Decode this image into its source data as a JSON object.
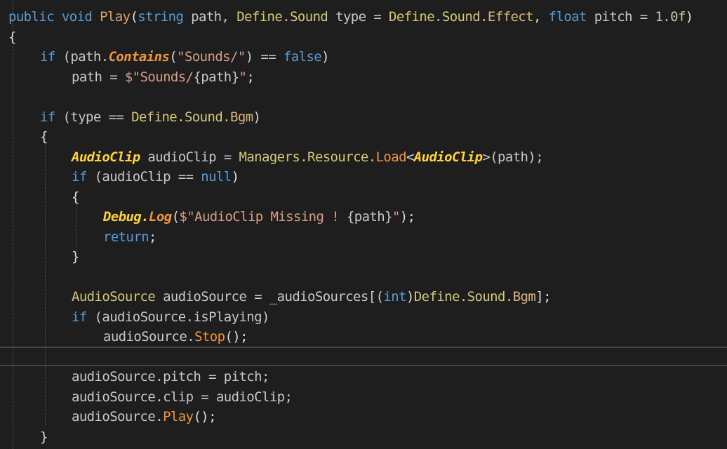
{
  "palette": {
    "background": "#1e1e1e",
    "keyword": "#569cd6",
    "method": "#dcdcaa",
    "method_orange": "#d8a36a",
    "enum_member": "#d8b47c",
    "class_type": "#d4c878",
    "class_italic": "#ffd23c",
    "ext_method": "#f09440",
    "string": "#d69d85",
    "identifier": "#c8c8c8",
    "number": "#b5cea8",
    "punctuation": "#dcdcdc",
    "indent_guide": "#4a4a4a",
    "current_line_border": "#464646"
  },
  "code_lines": [
    {
      "indent": 0,
      "tokens": [
        {
          "t": "public ",
          "k": "keyword"
        },
        {
          "t": "void ",
          "k": "keyword"
        },
        {
          "t": "Play",
          "k": "method_orange"
        },
        {
          "t": "(",
          "k": "punctuation"
        },
        {
          "t": "string ",
          "k": "keyword"
        },
        {
          "t": "path, ",
          "k": "identifier"
        },
        {
          "t": "Define.Sound ",
          "k": "class_type"
        },
        {
          "t": "type = ",
          "k": "identifier"
        },
        {
          "t": "Define.Sound.",
          "k": "class_type"
        },
        {
          "t": "Effect",
          "k": "enum_member"
        },
        {
          "t": ", ",
          "k": "punctuation"
        },
        {
          "t": "float ",
          "k": "keyword"
        },
        {
          "t": "pitch = ",
          "k": "identifier"
        },
        {
          "t": "1.0f",
          "k": "number"
        },
        {
          "t": ")",
          "k": "punctuation"
        }
      ]
    },
    {
      "indent": 0,
      "tokens": [
        {
          "t": "{",
          "k": "punctuation"
        }
      ]
    },
    {
      "indent": 1,
      "tokens": [
        {
          "t": "if ",
          "k": "keyword"
        },
        {
          "t": "(path.",
          "k": "identifier"
        },
        {
          "t": "Contains",
          "k": "ext_method",
          "i": true
        },
        {
          "t": "(",
          "k": "punctuation"
        },
        {
          "t": "\"Sounds/\"",
          "k": "string"
        },
        {
          "t": ") == ",
          "k": "identifier"
        },
        {
          "t": "false",
          "k": "keyword"
        },
        {
          "t": ")",
          "k": "punctuation"
        }
      ]
    },
    {
      "indent": 2,
      "tokens": [
        {
          "t": "path = ",
          "k": "identifier"
        },
        {
          "t": "$\"Sounds/",
          "k": "string"
        },
        {
          "t": "{path}",
          "k": "identifier"
        },
        {
          "t": "\"",
          "k": "string"
        },
        {
          "t": ";",
          "k": "punctuation"
        }
      ]
    },
    {
      "indent": 0,
      "tokens": []
    },
    {
      "indent": 1,
      "tokens": [
        {
          "t": "if ",
          "k": "keyword"
        },
        {
          "t": "(type == ",
          "k": "identifier"
        },
        {
          "t": "Define.Sound.",
          "k": "class_type"
        },
        {
          "t": "Bgm",
          "k": "enum_member"
        },
        {
          "t": ")",
          "k": "punctuation"
        }
      ]
    },
    {
      "indent": 1,
      "tokens": [
        {
          "t": "{",
          "k": "punctuation"
        }
      ]
    },
    {
      "indent": 2,
      "tokens": [
        {
          "t": "AudioClip",
          "k": "class_italic",
          "i": true
        },
        {
          "t": " audioClip = ",
          "k": "identifier"
        },
        {
          "t": "Managers.Resource.",
          "k": "class_type"
        },
        {
          "t": "Load",
          "k": "ext_method"
        },
        {
          "t": "<",
          "k": "punctuation"
        },
        {
          "t": "AudioClip",
          "k": "class_italic",
          "i": true
        },
        {
          "t": ">(path);",
          "k": "identifier"
        }
      ]
    },
    {
      "indent": 2,
      "tokens": [
        {
          "t": "if ",
          "k": "keyword"
        },
        {
          "t": "(audioClip == ",
          "k": "identifier"
        },
        {
          "t": "null",
          "k": "keyword"
        },
        {
          "t": ")",
          "k": "punctuation"
        }
      ]
    },
    {
      "indent": 2,
      "tokens": [
        {
          "t": "{",
          "k": "punctuation"
        }
      ]
    },
    {
      "indent": 3,
      "tokens": [
        {
          "t": "Debug.",
          "k": "class_italic",
          "i": true
        },
        {
          "t": "Log",
          "k": "ext_method",
          "i": true
        },
        {
          "t": "(",
          "k": "punctuation"
        },
        {
          "t": "$\"AudioClip Missing ! ",
          "k": "string"
        },
        {
          "t": "{path}",
          "k": "identifier"
        },
        {
          "t": "\"",
          "k": "string"
        },
        {
          "t": ");",
          "k": "punctuation"
        }
      ]
    },
    {
      "indent": 3,
      "tokens": [
        {
          "t": "return",
          "k": "keyword"
        },
        {
          "t": ";",
          "k": "punctuation"
        }
      ]
    },
    {
      "indent": 2,
      "tokens": [
        {
          "t": "}",
          "k": "punctuation"
        }
      ]
    },
    {
      "indent": 0,
      "tokens": []
    },
    {
      "indent": 2,
      "tokens": [
        {
          "t": "AudioSource",
          "k": "class_type"
        },
        {
          "t": " audioSource = _audioSources[(",
          "k": "identifier"
        },
        {
          "t": "int",
          "k": "keyword"
        },
        {
          "t": ")",
          "k": "punctuation"
        },
        {
          "t": "Define.Sound.",
          "k": "class_type"
        },
        {
          "t": "Bgm",
          "k": "enum_member"
        },
        {
          "t": "];",
          "k": "punctuation"
        }
      ]
    },
    {
      "indent": 2,
      "tokens": [
        {
          "t": "if ",
          "k": "keyword"
        },
        {
          "t": "(audioSource.isPlaying)",
          "k": "identifier"
        }
      ]
    },
    {
      "indent": 3,
      "tokens": [
        {
          "t": "audioSource.",
          "k": "identifier"
        },
        {
          "t": "Stop",
          "k": "ext_method"
        },
        {
          "t": "();",
          "k": "punctuation"
        }
      ]
    },
    {
      "indent": 0,
      "tokens": [],
      "current": true
    },
    {
      "indent": 2,
      "tokens": [
        {
          "t": "audioSource.pitch = pitch;",
          "k": "identifier"
        }
      ]
    },
    {
      "indent": 2,
      "tokens": [
        {
          "t": "audioSource.clip = audioClip;",
          "k": "identifier"
        }
      ]
    },
    {
      "indent": 2,
      "tokens": [
        {
          "t": "audioSource.",
          "k": "identifier"
        },
        {
          "t": "Play",
          "k": "ext_method"
        },
        {
          "t": "();",
          "k": "punctuation"
        }
      ]
    },
    {
      "indent": 1,
      "tokens": [
        {
          "t": "}",
          "k": "punctuation"
        }
      ]
    }
  ]
}
